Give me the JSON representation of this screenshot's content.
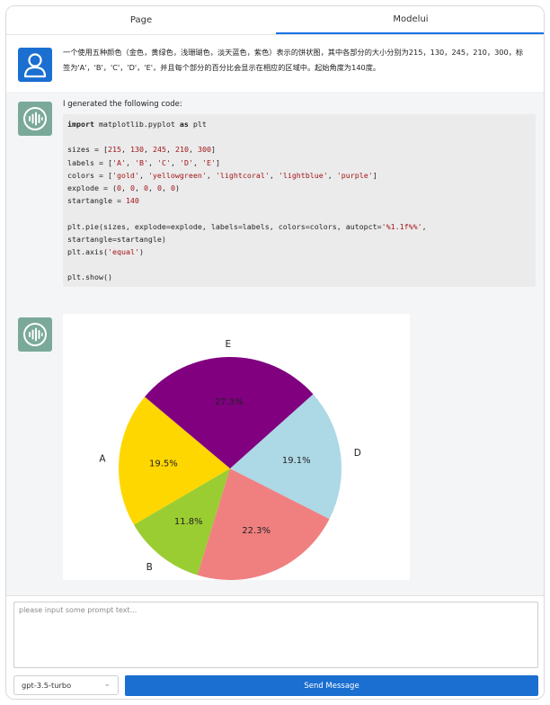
{
  "tabs": [
    {
      "label": "Page",
      "active": false
    },
    {
      "label": "Modelui",
      "active": true
    }
  ],
  "conversation": {
    "user_message": "一个使用五种颜色（金色，黄绿色，浅珊瑚色，淡天蓝色，紫色）表示的饼状图，其中各部分的大小分别为215，130，245，210，300，标签为'A'，'B'，'C'，'D'，'E'，并且每个部分的百分比会显示在相应的区域中。起始角度为140度。",
    "bot_intro": "I generated the following code:",
    "code_lines": [
      [
        {
          "t": "import",
          "c": "kw"
        },
        {
          "t": " matplotlib.pyplot ",
          "c": ""
        },
        {
          "t": "as",
          "c": "kw"
        },
        {
          "t": " plt",
          "c": ""
        }
      ],
      [],
      [
        {
          "t": "sizes = [",
          "c": ""
        },
        {
          "t": "215",
          "c": "num"
        },
        {
          "t": ", ",
          "c": ""
        },
        {
          "t": "130",
          "c": "num"
        },
        {
          "t": ", ",
          "c": ""
        },
        {
          "t": "245",
          "c": "num"
        },
        {
          "t": ", ",
          "c": ""
        },
        {
          "t": "210",
          "c": "num"
        },
        {
          "t": ", ",
          "c": ""
        },
        {
          "t": "300",
          "c": "num"
        },
        {
          "t": "]",
          "c": ""
        }
      ],
      [
        {
          "t": "labels = [",
          "c": ""
        },
        {
          "t": "'A'",
          "c": "str"
        },
        {
          "t": ", ",
          "c": ""
        },
        {
          "t": "'B'",
          "c": "str"
        },
        {
          "t": ", ",
          "c": ""
        },
        {
          "t": "'C'",
          "c": "str"
        },
        {
          "t": ", ",
          "c": ""
        },
        {
          "t": "'D'",
          "c": "str"
        },
        {
          "t": ", ",
          "c": ""
        },
        {
          "t": "'E'",
          "c": "str"
        },
        {
          "t": "]",
          "c": ""
        }
      ],
      [
        {
          "t": "colors = [",
          "c": ""
        },
        {
          "t": "'gold'",
          "c": "str"
        },
        {
          "t": ", ",
          "c": ""
        },
        {
          "t": "'yellowgreen'",
          "c": "str"
        },
        {
          "t": ", ",
          "c": ""
        },
        {
          "t": "'lightcoral'",
          "c": "str"
        },
        {
          "t": ", ",
          "c": ""
        },
        {
          "t": "'lightblue'",
          "c": "str"
        },
        {
          "t": ", ",
          "c": ""
        },
        {
          "t": "'purple'",
          "c": "str"
        },
        {
          "t": "]",
          "c": ""
        }
      ],
      [
        {
          "t": "explode = (",
          "c": ""
        },
        {
          "t": "0",
          "c": "num"
        },
        {
          "t": ", ",
          "c": ""
        },
        {
          "t": "0",
          "c": "num"
        },
        {
          "t": ", ",
          "c": ""
        },
        {
          "t": "0",
          "c": "num"
        },
        {
          "t": ", ",
          "c": ""
        },
        {
          "t": "0",
          "c": "num"
        },
        {
          "t": ", ",
          "c": ""
        },
        {
          "t": "0",
          "c": "num"
        },
        {
          "t": ")",
          "c": ""
        }
      ],
      [
        {
          "t": "startangle = ",
          "c": ""
        },
        {
          "t": "140",
          "c": "num"
        }
      ],
      [],
      [
        {
          "t": "plt.pie(sizes, explode=explode, labels=labels, colors=colors, autopct=",
          "c": ""
        },
        {
          "t": "'%1.1f%%'",
          "c": "str"
        },
        {
          "t": ",",
          "c": ""
        }
      ],
      [
        {
          "t": "startangle=startangle)",
          "c": ""
        }
      ],
      [
        {
          "t": "plt.axis(",
          "c": ""
        },
        {
          "t": "'equal'",
          "c": "str"
        },
        {
          "t": ")",
          "c": ""
        }
      ],
      [],
      [
        {
          "t": "plt.show()",
          "c": ""
        }
      ]
    ]
  },
  "chart_data": {
    "type": "pie",
    "labels": [
      "A",
      "B",
      "C",
      "D",
      "E"
    ],
    "values": [
      215,
      130,
      245,
      210,
      300
    ],
    "percent_labels": [
      "19.5%",
      "11.8%",
      "22.3%",
      "19.1%",
      "27.3%"
    ],
    "colors": [
      "#ffd700",
      "#9acd32",
      "#f08080",
      "#add8e6",
      "#800080"
    ],
    "startangle": 140,
    "direction": "counterclockwise"
  },
  "input": {
    "placeholder": "please input some prompt text...",
    "value": ""
  },
  "model_select": {
    "selected": "gpt-3.5-turbo"
  },
  "send_button": {
    "label": "Send Message"
  },
  "icons": {
    "user_avatar": "user-icon",
    "bot_avatar": "soundwave-icon",
    "select_chevron": "chevron-down-icon"
  },
  "colors": {
    "accent": "#1a6fd0",
    "bot_avatar_bg": "#7aa99a",
    "chat_bg": "#f4f5f6",
    "code_bg": "#ebebec"
  }
}
